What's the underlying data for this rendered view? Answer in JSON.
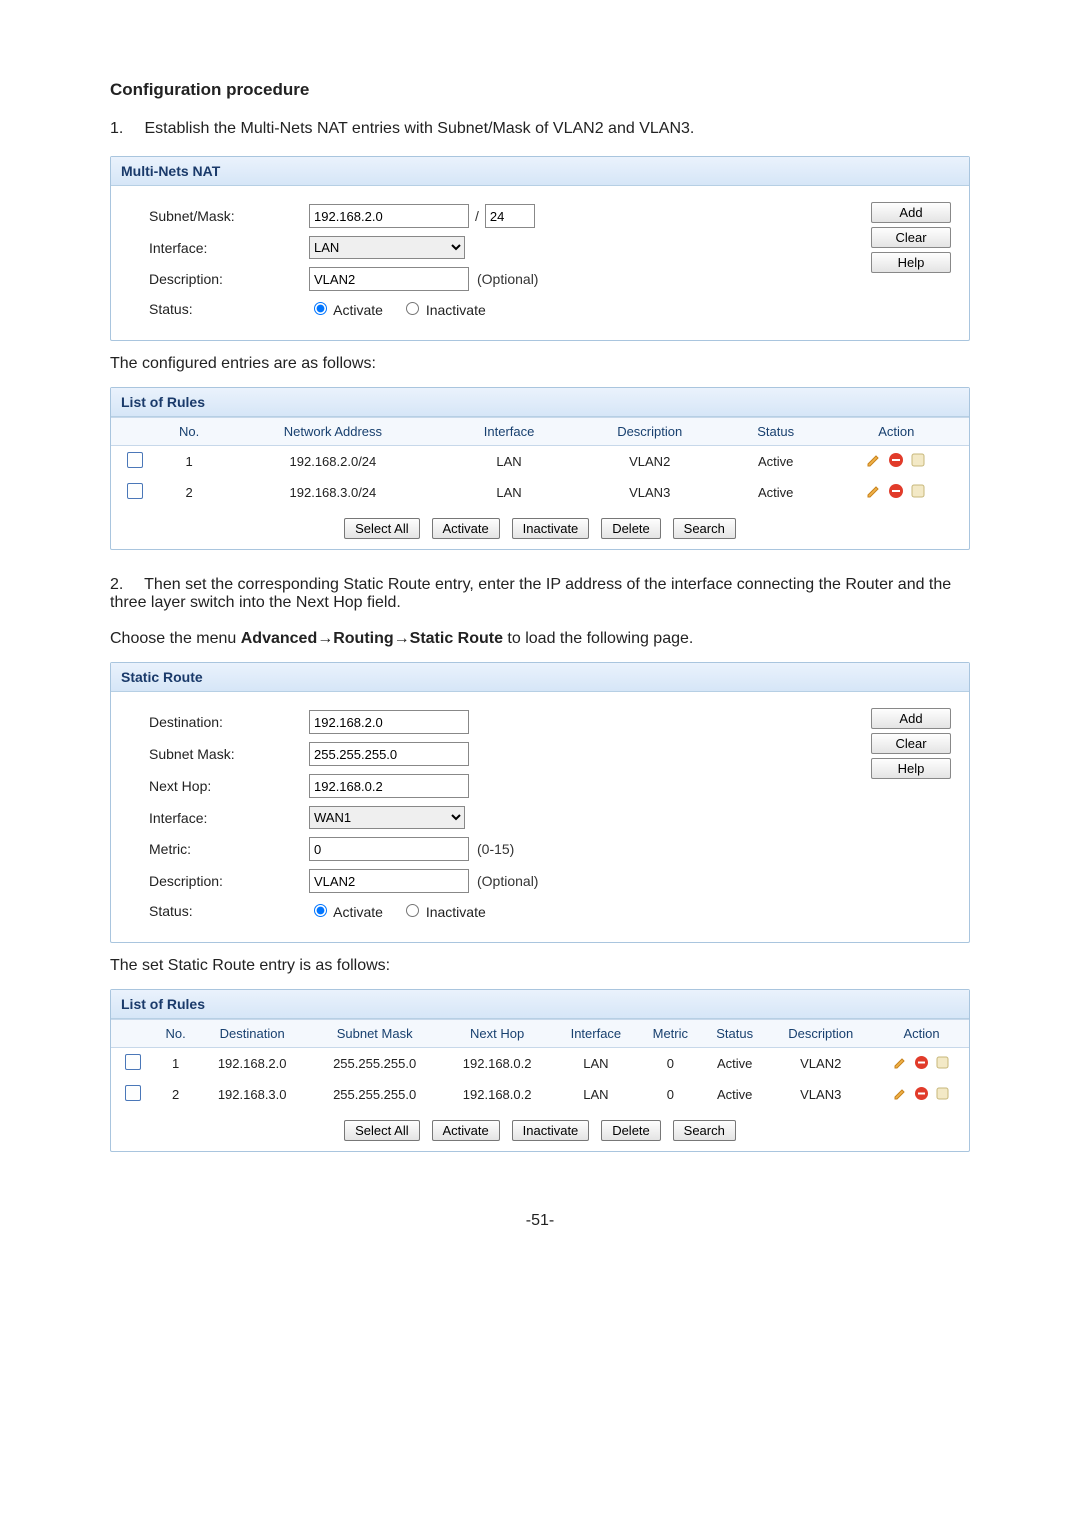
{
  "headings": {
    "config_proc": "Configuration procedure",
    "configured_entries": "The configured entries are as follows:",
    "static_intro": "The set Static Route entry is as follows:"
  },
  "steps": {
    "one_num": "1.",
    "one_text": "Establish the Multi-Nets NAT entries with Subnet/Mask of VLAN2 and VLAN3.",
    "two_num": "2.",
    "two_text": "Then set the corresponding Static Route entry, enter the IP address of the interface connecting the Router and the three layer switch into the Next Hop field."
  },
  "menu_sentence_pre": "Choose the menu ",
  "menu_sentence_bold": "Advanced→Routing→Static Route",
  "menu_sentence_post": " to load the following page.",
  "multi_nets": {
    "title": "Multi-Nets NAT",
    "subnet_label": "Subnet/Mask:",
    "subnet_ip": "192.168.2.0",
    "subnet_cidr": "24",
    "interface_label": "Interface:",
    "interface_value": "LAN",
    "description_label": "Description:",
    "description_value": "VLAN2",
    "optional": "(Optional)",
    "status_label": "Status:",
    "status_activate": "Activate",
    "status_inactivate": "Inactivate"
  },
  "buttons": {
    "add": "Add",
    "clear": "Clear",
    "help": "Help",
    "select_all": "Select All",
    "activate": "Activate",
    "inactivate": "Inactivate",
    "delete": "Delete",
    "search": "Search"
  },
  "rules1": {
    "title": "List of Rules",
    "cols": {
      "no": "No.",
      "net": "Network Address",
      "iface": "Interface",
      "desc": "Description",
      "status": "Status",
      "action": "Action"
    },
    "rows": [
      {
        "no": "1",
        "net": "192.168.2.0/24",
        "iface": "LAN",
        "desc": "VLAN2",
        "status": "Active"
      },
      {
        "no": "2",
        "net": "192.168.3.0/24",
        "iface": "LAN",
        "desc": "VLAN3",
        "status": "Active"
      }
    ]
  },
  "static": {
    "title": "Static Route",
    "dest_label": "Destination:",
    "dest": "192.168.2.0",
    "mask_label": "Subnet Mask:",
    "mask": "255.255.255.0",
    "hop_label": "Next Hop:",
    "hop": "192.168.0.2",
    "iface_label": "Interface:",
    "iface": "WAN1",
    "metric_label": "Metric:",
    "metric": "0",
    "metric_range": "(0-15)",
    "desc_label": "Description:",
    "desc": "VLAN2",
    "optional": "(Optional)",
    "status_label": "Status:",
    "status_activate": "Activate",
    "status_inactivate": "Inactivate"
  },
  "rules2": {
    "title": "List of Rules",
    "cols": {
      "no": "No.",
      "dest": "Destination",
      "mask": "Subnet Mask",
      "hop": "Next Hop",
      "iface": "Interface",
      "metric": "Metric",
      "status": "Status",
      "desc": "Description",
      "action": "Action"
    },
    "rows": [
      {
        "no": "1",
        "dest": "192.168.2.0",
        "mask": "255.255.255.0",
        "hop": "192.168.0.2",
        "iface": "LAN",
        "metric": "0",
        "status": "Active",
        "desc": "VLAN2"
      },
      {
        "no": "2",
        "dest": "192.168.3.0",
        "mask": "255.255.255.0",
        "hop": "192.168.0.2",
        "iface": "LAN",
        "metric": "0",
        "status": "Active",
        "desc": "VLAN3"
      }
    ]
  },
  "footer": "-51-"
}
